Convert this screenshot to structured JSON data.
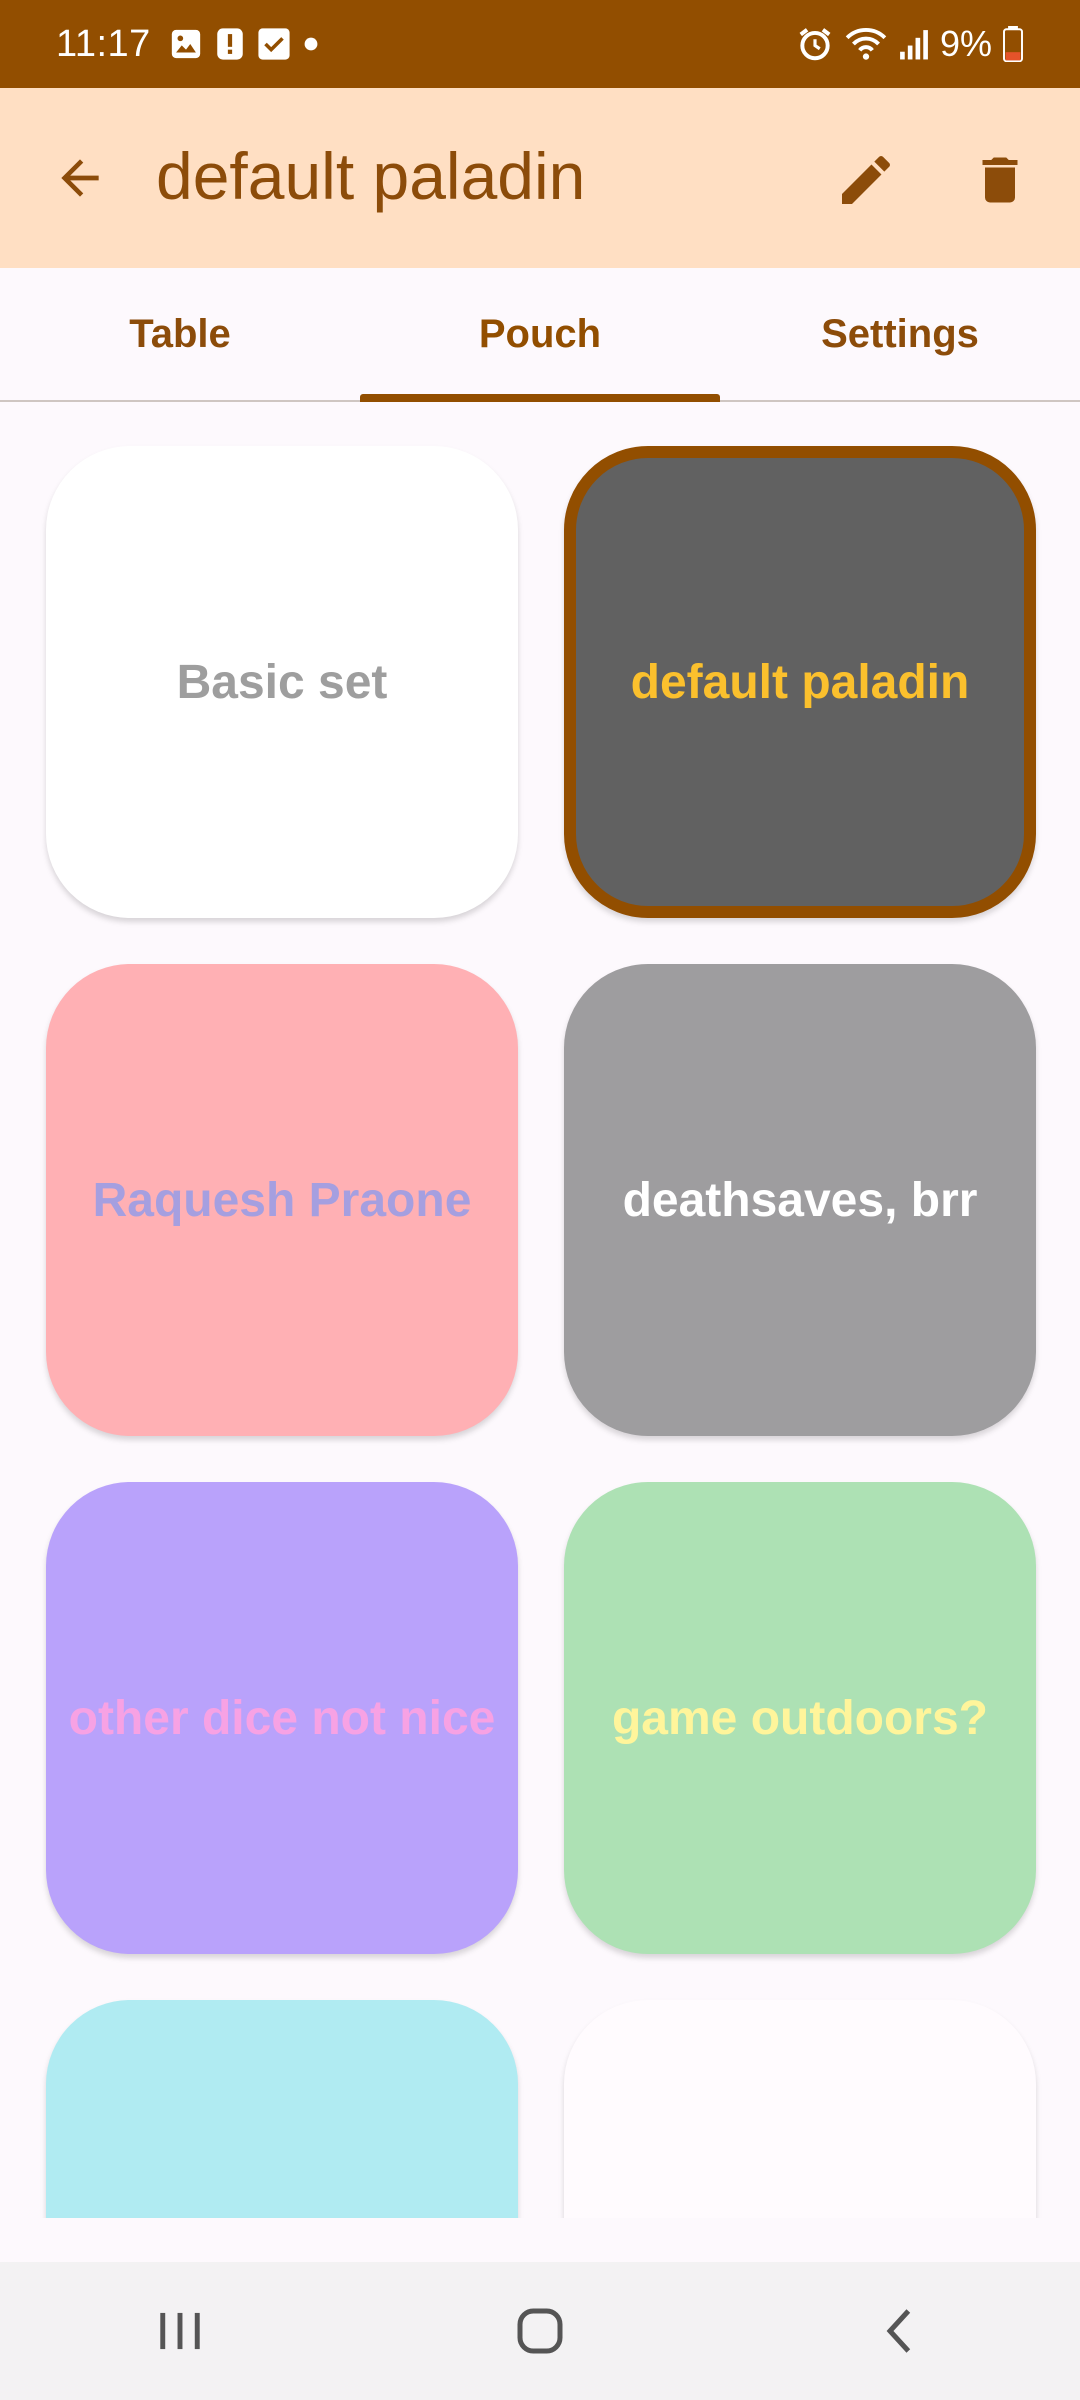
{
  "status_bar": {
    "time": "11:17",
    "battery": "9%",
    "icons_left": [
      "image-icon",
      "alert-icon",
      "check-icon",
      "dot-icon"
    ],
    "icons_right": [
      "alarm-icon",
      "wifi-icon",
      "signal-icon",
      "battery-icon"
    ]
  },
  "app_bar": {
    "title": "default paladin",
    "back_icon": "arrow-back-icon",
    "edit_icon": "pencil-icon",
    "delete_icon": "trash-icon"
  },
  "tabs": [
    {
      "label": "Table",
      "selected": false
    },
    {
      "label": "Pouch",
      "selected": true
    },
    {
      "label": "Settings",
      "selected": false
    }
  ],
  "sets": [
    {
      "label": "Basic set",
      "bg": "#ffffff",
      "fg": "#9e9e9e",
      "selected": false
    },
    {
      "label": "default paladin",
      "bg": "#616161",
      "fg": "#fbc02d",
      "selected": true
    },
    {
      "label": "Raquesh Praone",
      "bg": "#ffb0b4",
      "fg": "#a59fe0",
      "selected": false
    },
    {
      "label": "deathsaves, brr",
      "bg": "#9e9d9f",
      "fg": "#ffffff",
      "selected": false
    },
    {
      "label": "other dice not nice",
      "bg": "#b9a2fb",
      "fg": "#f7a2e4",
      "selected": false
    },
    {
      "label": "game outdoors?",
      "bg": "#ade1b4",
      "fg": "#fff59b",
      "selected": false
    },
    {
      "label": "",
      "bg": "#b0ebf2",
      "fg": "#ffffff",
      "selected": false
    },
    {
      "label": "",
      "bg": "#fffbfe",
      "fg": "#9e9e9e",
      "selected": false
    }
  ],
  "colors": {
    "status_bar": "#924e00",
    "app_bar": "#ffdfc3",
    "accent": "#924e00",
    "title_text": "#8c4c0a"
  },
  "nav_bar": {
    "icons": [
      "recent-apps-icon",
      "home-icon",
      "back-nav-icon"
    ]
  }
}
